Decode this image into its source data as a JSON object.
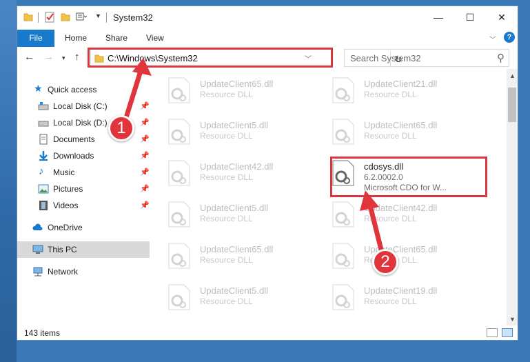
{
  "window": {
    "title": "System32",
    "controls": {
      "minimize": "—",
      "maximize": "☐",
      "close": "✕"
    }
  },
  "ribbon": {
    "tabs": [
      "File",
      "Home",
      "Share",
      "View"
    ]
  },
  "navigation": {
    "address": "C:\\Windows\\System32",
    "search_placeholder": "Search System32"
  },
  "sidebar": {
    "items": [
      {
        "label": "Quick access",
        "icon": "star-icon",
        "pinned": false
      },
      {
        "label": "Local Disk (C:)",
        "icon": "drive-icon",
        "pinned": true
      },
      {
        "label": "Local Disk (D:)",
        "icon": "drive-icon",
        "pinned": true
      },
      {
        "label": "Documents",
        "icon": "documents-icon",
        "pinned": true
      },
      {
        "label": "Downloads",
        "icon": "downloads-icon",
        "pinned": true
      },
      {
        "label": "Music",
        "icon": "music-icon",
        "pinned": true
      },
      {
        "label": "Pictures",
        "icon": "pictures-icon",
        "pinned": true
      },
      {
        "label": "Videos",
        "icon": "videos-icon",
        "pinned": true
      },
      {
        "label": "OneDrive",
        "icon": "cloud-icon",
        "pinned": false
      },
      {
        "label": "This PC",
        "icon": "computer-icon",
        "pinned": false
      },
      {
        "label": "Network",
        "icon": "network-icon",
        "pinned": false
      }
    ]
  },
  "files": [
    {
      "name": "UpdateClient65.dll",
      "desc": "Resource DLL"
    },
    {
      "name": "UpdateClient21.dll",
      "desc": "Resource DLL"
    },
    {
      "name": "UpdateClient5.dll",
      "desc": "Resource DLL"
    },
    {
      "name": "UpdateClient65.dll",
      "desc": "Resource DLL"
    },
    {
      "name": "UpdateClient42.dll",
      "desc": "Resource DLL"
    },
    {
      "name": "cdosys.dll",
      "desc": "6.2.0002.0",
      "desc2": "Microsoft CDO for W...",
      "active": true
    },
    {
      "name": "UpdateClient5.dll",
      "desc": "Resource DLL"
    },
    {
      "name": "UpdateClient42.dll",
      "desc": "Resource DLL"
    },
    {
      "name": "UpdateClient65.dll",
      "desc": "Resource DLL"
    },
    {
      "name": "UpdateClient65.dll",
      "desc": "Resource DLL"
    },
    {
      "name": "UpdateClient5.dll",
      "desc": "Resource DLL"
    },
    {
      "name": "UpdateClient19.dll",
      "desc": "Resource DLL"
    }
  ],
  "status": {
    "item_count": "143 items"
  },
  "annotations": {
    "step1": "1",
    "step2": "2"
  },
  "colors": {
    "accent": "#1979ca",
    "annotation": "#d9363e",
    "selection": "#cce8ff"
  }
}
